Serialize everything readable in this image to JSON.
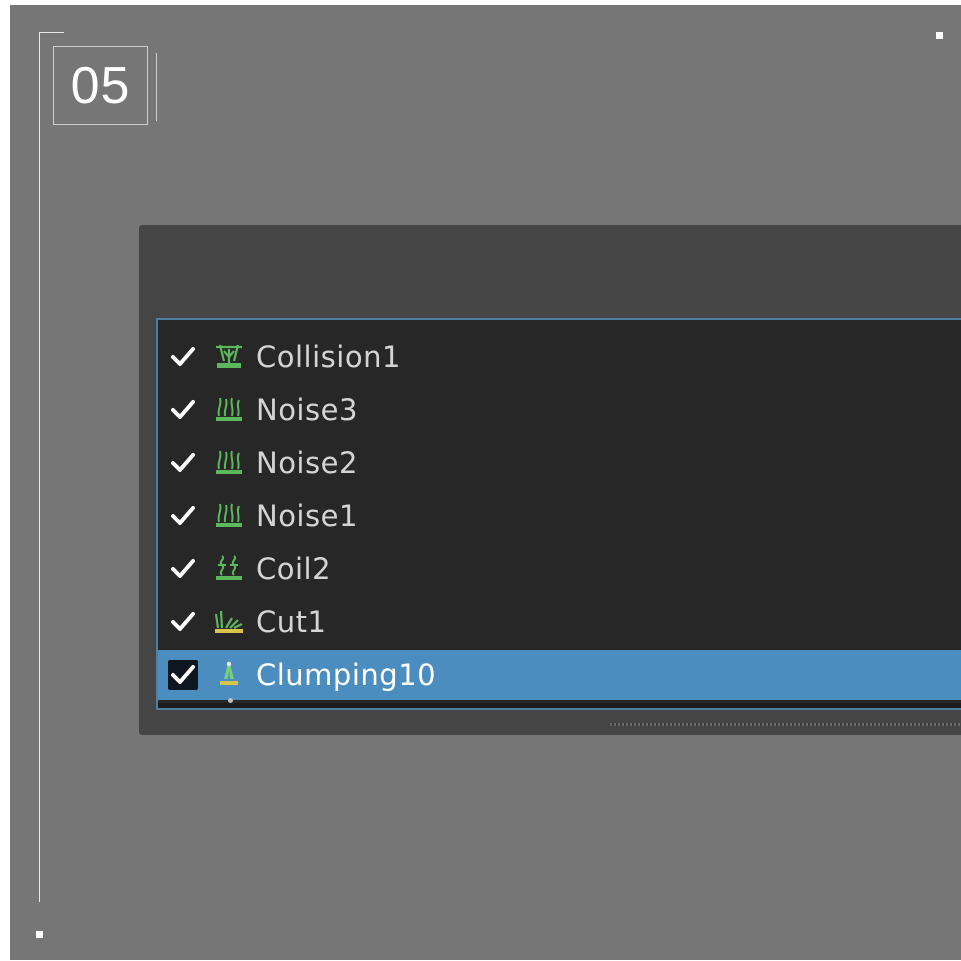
{
  "step": {
    "number": "05"
  },
  "outliner": {
    "items": [
      {
        "label": "Collision1",
        "icon": "collision-modifier-icon",
        "checked": true,
        "selected": false
      },
      {
        "label": "Noise3",
        "icon": "noise-modifier-icon",
        "checked": true,
        "selected": false
      },
      {
        "label": "Noise2",
        "icon": "noise-modifier-icon",
        "checked": true,
        "selected": false
      },
      {
        "label": "Noise1",
        "icon": "noise-modifier-icon",
        "checked": true,
        "selected": false
      },
      {
        "label": "Coil2",
        "icon": "coil-modifier-icon",
        "checked": true,
        "selected": false
      },
      {
        "label": "Cut1",
        "icon": "cut-modifier-icon",
        "checked": true,
        "selected": false
      },
      {
        "label": "Clumping10",
        "icon": "clumping-modifier-icon",
        "checked": true,
        "selected": true
      }
    ]
  },
  "colors": {
    "background": "#767676",
    "panel": "#454545",
    "list": "#272727",
    "selection": "#4b8dbf",
    "icon_green": "#5cb85c"
  }
}
